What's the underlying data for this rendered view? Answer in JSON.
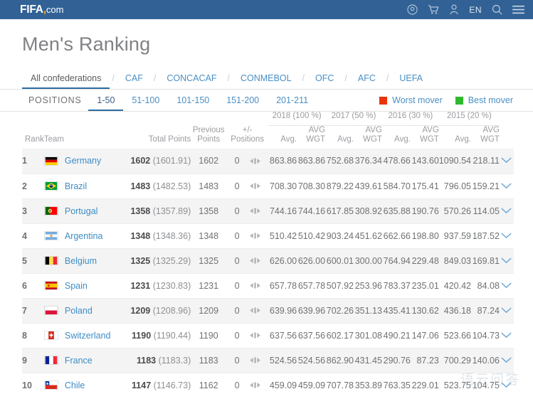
{
  "topbar": {
    "logo_fifa": "FIFA",
    "logo_comma": ",",
    "logo_com": "com",
    "icons": [
      "football-icon",
      "cart-icon",
      "user-icon",
      "search-icon",
      "menu-icon"
    ],
    "language": "EN"
  },
  "page": {
    "title": "Men's Ranking"
  },
  "confederations": {
    "separator": "/",
    "items": [
      {
        "label": "All confederations",
        "active": true
      },
      {
        "label": "CAF",
        "active": false
      },
      {
        "label": "CONCACAF",
        "active": false
      },
      {
        "label": "CONMEBOL",
        "active": false
      },
      {
        "label": "OFC",
        "active": false
      },
      {
        "label": "AFC",
        "active": false
      },
      {
        "label": "UEFA",
        "active": false
      }
    ]
  },
  "positions": {
    "label": "POSITIONS",
    "ranges": [
      {
        "label": "1-50",
        "active": true
      },
      {
        "label": "51-100",
        "active": false
      },
      {
        "label": "101-150",
        "active": false
      },
      {
        "label": "151-200",
        "active": false
      },
      {
        "label": "201-211",
        "active": false
      }
    ],
    "movers": [
      {
        "label": "Worst mover",
        "color": "#e8340c"
      },
      {
        "label": "Best mover",
        "color": "#2eb82e"
      }
    ]
  },
  "table": {
    "year_headers": [
      "2018 (100 %)",
      "2017 (50 %)",
      "2016 (30 %)",
      "2015 (20 %)"
    ],
    "headers": {
      "rank": "Rank",
      "team": "Team",
      "total_points": "Total Points",
      "previous_points": "Previous Points",
      "positions_delta": "+/-Positions",
      "avg": "Avg.",
      "avg_wgt": "AVG WGT"
    },
    "rows": [
      {
        "rank": "1",
        "team": "Germany",
        "flag": "germany",
        "total_main": "1602",
        "total_sub": "(1601.91)",
        "previous": "1602",
        "delta": "0",
        "values": [
          "863.86",
          "863.86",
          "752.68",
          "376.34",
          "478.66",
          "143.60",
          "1090.54",
          "218.11"
        ]
      },
      {
        "rank": "2",
        "team": "Brazil",
        "flag": "brazil",
        "total_main": "1483",
        "total_sub": "(1482.53)",
        "previous": "1483",
        "delta": "0",
        "values": [
          "708.30",
          "708.30",
          "879.22",
          "439.61",
          "584.70",
          "175.41",
          "796.05",
          "159.21"
        ]
      },
      {
        "rank": "3",
        "team": "Portugal",
        "flag": "portugal",
        "total_main": "1358",
        "total_sub": "(1357.89)",
        "previous": "1358",
        "delta": "0",
        "values": [
          "744.16",
          "744.16",
          "617.85",
          "308.92",
          "635.88",
          "190.76",
          "570.26",
          "114.05"
        ]
      },
      {
        "rank": "4",
        "team": "Argentina",
        "flag": "argentina",
        "total_main": "1348",
        "total_sub": "(1348.36)",
        "previous": "1348",
        "delta": "0",
        "values": [
          "510.42",
          "510.42",
          "903.24",
          "451.62",
          "662.66",
          "198.80",
          "937.59",
          "187.52"
        ]
      },
      {
        "rank": "5",
        "team": "Belgium",
        "flag": "belgium",
        "total_main": "1325",
        "total_sub": "(1325.29)",
        "previous": "1325",
        "delta": "0",
        "values": [
          "626.00",
          "626.00",
          "600.01",
          "300.00",
          "764.94",
          "229.48",
          "849.03",
          "169.81"
        ]
      },
      {
        "rank": "6",
        "team": "Spain",
        "flag": "spain",
        "total_main": "1231",
        "total_sub": "(1230.83)",
        "previous": "1231",
        "delta": "0",
        "values": [
          "657.78",
          "657.78",
          "507.92",
          "253.96",
          "783.37",
          "235.01",
          "420.42",
          "84.08"
        ]
      },
      {
        "rank": "7",
        "team": "Poland",
        "flag": "poland",
        "total_main": "1209",
        "total_sub": "(1208.96)",
        "previous": "1209",
        "delta": "0",
        "values": [
          "639.96",
          "639.96",
          "702.26",
          "351.13",
          "435.41",
          "130.62",
          "436.18",
          "87.24"
        ]
      },
      {
        "rank": "8",
        "team": "Switzerland",
        "flag": "switzerland",
        "total_main": "1190",
        "total_sub": "(1190.44)",
        "previous": "1190",
        "delta": "0",
        "values": [
          "637.56",
          "637.56",
          "602.17",
          "301.08",
          "490.21",
          "147.06",
          "523.66",
          "104.73"
        ]
      },
      {
        "rank": "9",
        "team": "France",
        "flag": "france",
        "total_main": "1183",
        "total_sub": "(1183.3)",
        "previous": "1183",
        "delta": "0",
        "values": [
          "524.56",
          "524.56",
          "862.90",
          "431.45",
          "290.76",
          "87.23",
          "700.29",
          "140.06"
        ]
      },
      {
        "rank": "10",
        "team": "Chile",
        "flag": "chile",
        "total_main": "1147",
        "total_sub": "(1146.73)",
        "previous": "1162",
        "delta": "0",
        "values": [
          "459.09",
          "459.09",
          "707.78",
          "353.89",
          "763.35",
          "229.01",
          "523.75",
          "104.75"
        ]
      }
    ]
  },
  "watermark": "语云问答"
}
